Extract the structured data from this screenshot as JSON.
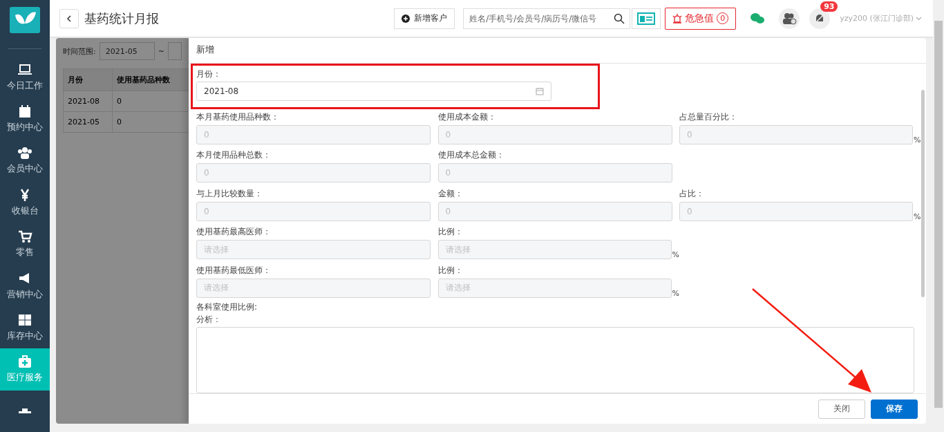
{
  "sidebar": {
    "items": [
      {
        "label": "今日工作",
        "selected": false
      },
      {
        "label": "预约中心",
        "selected": false
      },
      {
        "label": "会员中心",
        "selected": false
      },
      {
        "label": "收银台",
        "selected": false
      },
      {
        "label": "零售",
        "selected": false
      },
      {
        "label": "营销中心",
        "selected": false
      },
      {
        "label": "库存中心",
        "selected": false
      },
      {
        "label": "医疗服务",
        "selected": true
      },
      {
        "selected": false
      }
    ]
  },
  "header": {
    "title": "基药统计月报",
    "new_customer": "新增客户",
    "search": {
      "placeholder": "姓名/手机号/会员号/病历号/微信号"
    },
    "alert": {
      "label": "危急值",
      "count": "0"
    },
    "notifications": "93",
    "user": "yzy200 (张江门诊部)"
  },
  "background_page": {
    "filter_label": "时间范围:",
    "date_from": "2021-05",
    "separator": "~",
    "table": {
      "columns": [
        "月份",
        "使用基药品种数"
      ],
      "rows": [
        [
          "2021-08",
          "0"
        ],
        [
          "2021-05",
          "0"
        ]
      ]
    }
  },
  "drawer": {
    "title": "新增",
    "month": {
      "label": "月份：",
      "value": "2021-08"
    },
    "rows": [
      [
        {
          "label": "本月基药使用品种数：",
          "kind": "input",
          "value": "0"
        },
        {
          "label": "使用成本金额：",
          "kind": "input",
          "value": "0"
        },
        {
          "label": "占总量百分比：",
          "kind": "input",
          "value": "0",
          "suffix": "%"
        }
      ],
      [
        {
          "label": "本月使用品种总数：",
          "kind": "input",
          "value": "0"
        },
        {
          "label": "使用成本总金额：",
          "kind": "input",
          "value": "0"
        }
      ],
      [
        {
          "label": "与上月比较数量：",
          "kind": "input",
          "value": "0"
        },
        {
          "label": "金额：",
          "kind": "input",
          "value": "0"
        },
        {
          "label": "占比：",
          "kind": "input",
          "value": "0",
          "suffix": "%"
        }
      ],
      [
        {
          "label": "使用基药最高医师：",
          "kind": "select",
          "placeholder": "请选择"
        },
        {
          "label": "比例：",
          "kind": "select",
          "placeholder": "请选择",
          "suffix": "%"
        }
      ],
      [
        {
          "label": "使用基药最低医师：",
          "kind": "select",
          "placeholder": "请选择"
        },
        {
          "label": "比例：",
          "kind": "select",
          "placeholder": "请选择",
          "suffix": "%"
        }
      ]
    ],
    "dept_label": "各科室使用比例:",
    "analysis_label": "分析：",
    "buttons": [
      {
        "label": "关闭",
        "kind": "default"
      },
      {
        "label": "保存",
        "kind": "primary"
      }
    ]
  }
}
